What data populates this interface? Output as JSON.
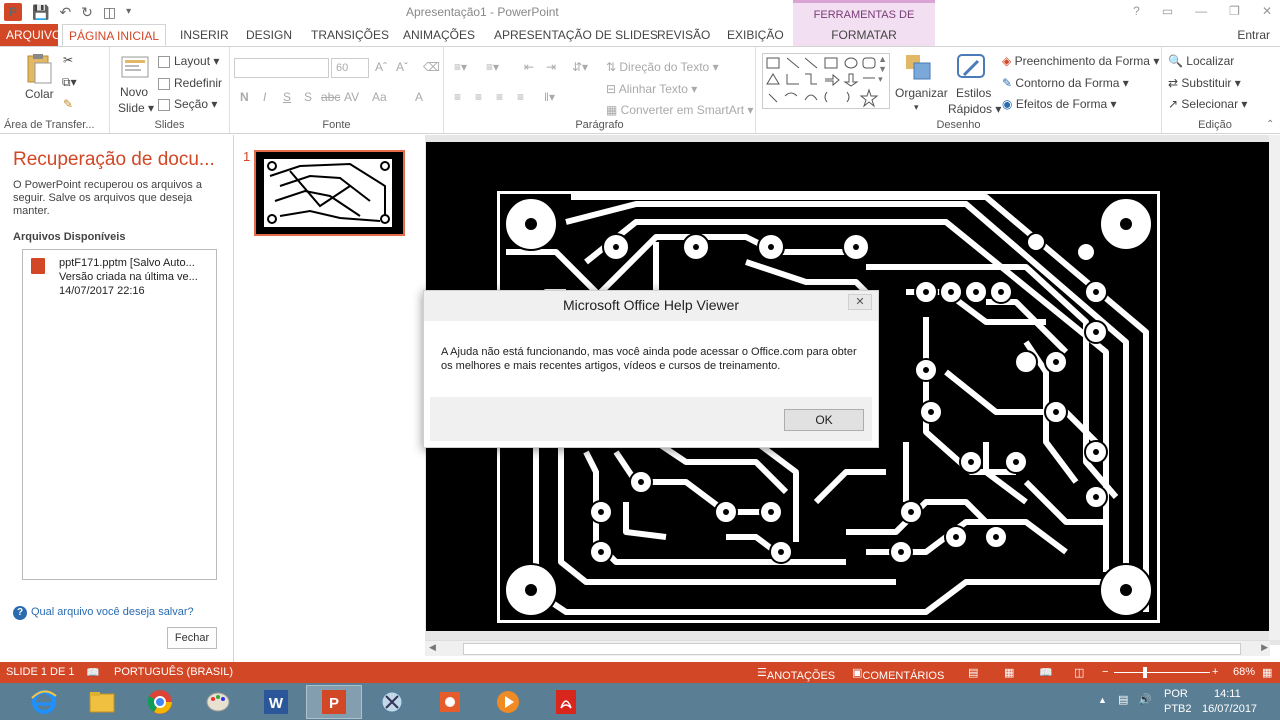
{
  "window": {
    "title": "Apresentação1 - PowerPoint",
    "context_header": "FERRAMENTAS DE IMAGEM",
    "sign_in": "Entrar",
    "controls": [
      "?",
      "▭",
      "—",
      "❐",
      "✕"
    ]
  },
  "qat": {
    "app_icon": "P"
  },
  "tabs": [
    "ARQUIVO",
    "PÁGINA INICIAL",
    "INSERIR",
    "DESIGN",
    "TRANSIÇÕES",
    "ANIMAÇÕES",
    "APRESENTAÇÃO DE SLIDES",
    "REVISÃO",
    "EXIBIÇÃO",
    "FORMATAR"
  ],
  "ribbon": {
    "clipboard": {
      "paste": "Colar",
      "label": "Área de Transfer..."
    },
    "slides": {
      "new_slide_1": "Novo",
      "new_slide_2": "Slide",
      "layout": "Layout",
      "reset": "Redefinir",
      "section": "Seção",
      "label": "Slides"
    },
    "font": {
      "size": "60",
      "label": "Fonte",
      "buttons": [
        "N",
        "I",
        "S",
        "S",
        "abc",
        "AV",
        "Aa",
        "A"
      ]
    },
    "paragraph": {
      "text_direction": "Direção do Texto",
      "align_text": "Alinhar Texto",
      "smartart": "Converter em SmartArt",
      "label": "Parágrafo"
    },
    "drawing": {
      "arrange": "Organizar",
      "quick_styles_1": "Estilos",
      "quick_styles_2": "Rápidos",
      "shape_fill": "Preenchimento da Forma",
      "shape_outline": "Contorno da Forma",
      "shape_effects": "Efeitos de Forma",
      "label": "Desenho"
    },
    "editing": {
      "find": "Localizar",
      "replace": "Substituir",
      "select": "Selecionar",
      "label": "Edição"
    }
  },
  "recovery": {
    "title": "Recuperação de docu...",
    "description": "O PowerPoint recuperou os arquivos a seguir. Salve os arquivos que deseja manter.",
    "available_header": "Arquivos Disponíveis",
    "file": {
      "name": "pptF171.pptm  [Salvo Auto...",
      "version": "Versão criada na última ve...",
      "date": "14/07/2017 22:16"
    },
    "question": "Qual arquivo você deseja salvar?",
    "close_button": "Fechar"
  },
  "thumbnails": {
    "slide_number": "1"
  },
  "dialog": {
    "title": "Microsoft Office Help Viewer",
    "message": "A Ajuda não está funcionando, mas você ainda pode acessar o Office.com para obter os melhores e mais recentes artigos, vídeos e cursos de treinamento.",
    "ok": "OK",
    "close": "✕"
  },
  "status": {
    "slide": "SLIDE 1 DE 1",
    "language": "PORTUGUÊS (BRASIL)",
    "notes": "ANOTAÇÕES",
    "comments": "COMENTÁRIOS",
    "zoom": "68%"
  },
  "taskbar": {
    "apps": [
      "internet-explorer",
      "file-explorer",
      "chrome",
      "paint",
      "word",
      "powerpoint",
      "snipping-tool",
      "office-app",
      "media-player",
      "acrobat"
    ],
    "lang_1": "POR",
    "lang_2": "PTB2",
    "time": "14:11",
    "date": "16/07/2017"
  },
  "colors": {
    "accent": "#d24726",
    "context_tab": "#f3dff2",
    "taskbar": "#5a7e93"
  }
}
